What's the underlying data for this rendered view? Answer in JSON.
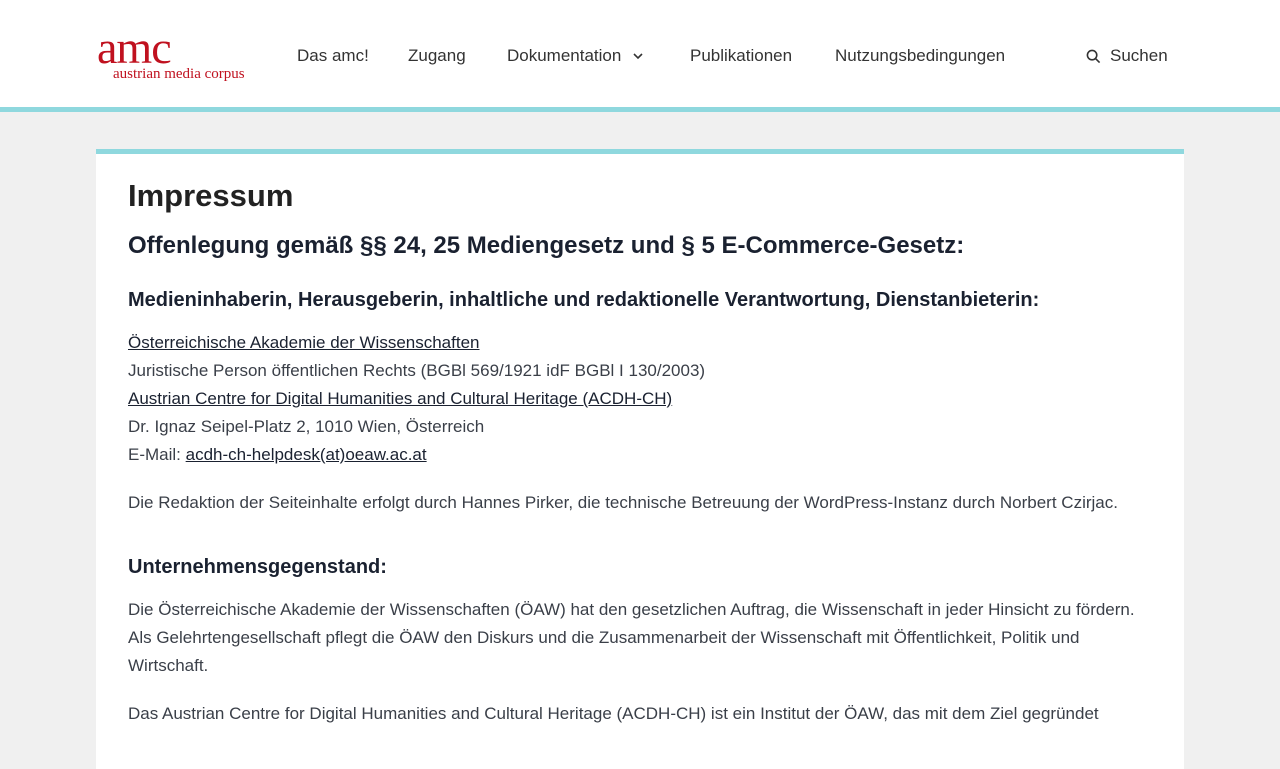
{
  "header": {
    "logo_main": "amc",
    "logo_sub": "austrian media corpus",
    "nav": {
      "das_amc": "Das amc!",
      "zugang": "Zugang",
      "dokumentation": "Dokumentation",
      "publikationen": "Publikationen",
      "nutzungsbedingungen": "Nutzungsbedingungen"
    },
    "search_label": "Suchen"
  },
  "main": {
    "title": "Impressum",
    "heading": "Offenlegung gemäß §§ 24, 25 Mediengesetz und § 5 E-Commerce-Gesetz:",
    "owner_heading": "Medieninhaberin, Herausgeberin, inhaltliche und redaktionelle Verantwortung, Dienstanbieterin:",
    "owner": {
      "academy_link": "Österreichische Akademie der Wissenschaften",
      "legal_person": "Juristische Person öffentlichen Rechts (BGBl 569/1921 idF BGBl I 130/2003)",
      "acdh_link": "Austrian Centre for Digital Humanities and Cultural Heritage (ACDH-CH)",
      "address": "Dr. Ignaz Seipel-Platz 2, 1010 Wien, Österreich",
      "email_label": "E-Mail:",
      "email_link": "acdh-ch-helpdesk(at)oeaw.ac.at"
    },
    "editorial_note": "Die Redaktion der Seiteinhalte erfolgt durch Hannes Pirker, die technische Betreuung der WordPress-Instanz durch Norbert Czirjac.",
    "purpose_heading": "Unternehmensgegenstand:",
    "purpose_paragraph": "Die Österreichische Akademie der Wissenschaften (ÖAW) hat den gesetzlichen Auftrag, die Wissenschaft in jeder Hinsicht zu fördern. Als Gelehrtengesellschaft pflegt die ÖAW den Diskurs und die Zusammenarbeit der Wissenschaft mit Öffentlichkeit, Politik und Wirtschaft.",
    "acdh_paragraph": "Das Austrian Centre for Digital Humanities and Cultural Heritage (ACDH-CH) ist ein Institut der ÖAW, das mit dem Ziel gegründet"
  },
  "colors": {
    "brand_red": "#c0111f",
    "accent_teal": "#8fd8de",
    "background": "#f0f0f0"
  },
  "icons": {
    "dropdown": "chevron-down-icon",
    "search": "search-icon"
  }
}
